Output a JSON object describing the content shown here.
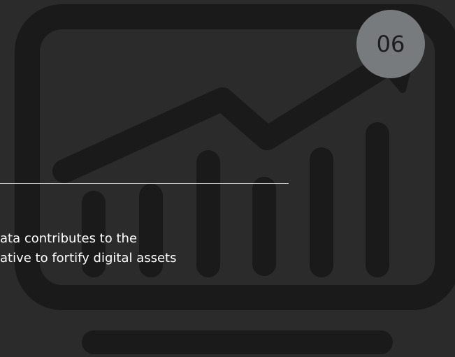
{
  "slide": {
    "number_badge": "06",
    "text_lines": [
      "ata contributes to the",
      "ative to fortify digital assets"
    ]
  },
  "icons": {
    "background": "monitor-chart-icon"
  },
  "colors": {
    "background": "#2b2b2b",
    "icon": "#1a1a1a",
    "badge": "#777b7e",
    "divider": "#d9d9d9",
    "text": "#ffffff"
  }
}
